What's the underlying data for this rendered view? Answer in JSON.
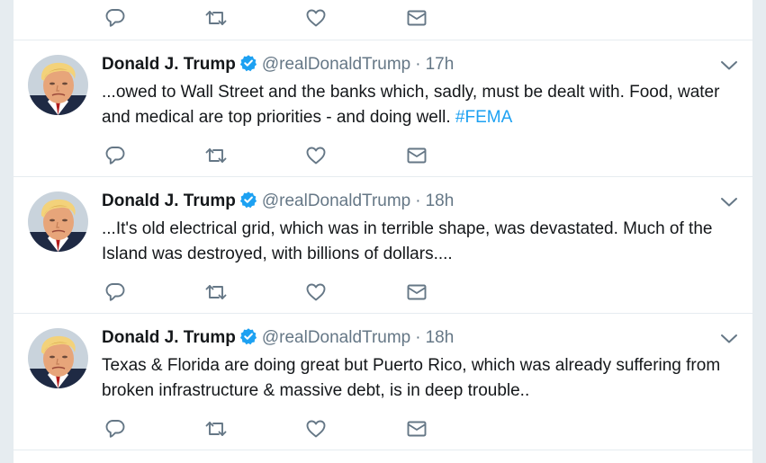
{
  "colors": {
    "background": "#e6ecf0",
    "card": "#ffffff",
    "text": "#14171a",
    "muted": "#657786",
    "link": "#1da1f2",
    "verified": "#1da1f2"
  },
  "actions": [
    "reply-icon",
    "retweet-icon",
    "like-icon",
    "direct-message-icon"
  ],
  "tweets": [
    {
      "fullname": "Donald J. Trump",
      "handle": "@realDonaldTrump",
      "separator": "·",
      "time": "17h",
      "text": "...owed to Wall Street and the banks which, sadly, must be dealt with. Food, water and medical are top priorities - and doing well.",
      "hashtag": "#FEMA"
    },
    {
      "fullname": "Donald J. Trump",
      "handle": "@realDonaldTrump",
      "separator": "·",
      "time": "18h",
      "text": "...It's old electrical grid, which was in terrible shape, was devastated. Much of the Island was destroyed, with billions of dollars....",
      "hashtag": ""
    },
    {
      "fullname": "Donald J. Trump",
      "handle": "@realDonaldTrump",
      "separator": "·",
      "time": "18h",
      "text": "Texas & Florida are doing great but Puerto Rico, which was already suffering from broken infrastructure & massive debt, is in deep trouble..",
      "hashtag": ""
    }
  ]
}
